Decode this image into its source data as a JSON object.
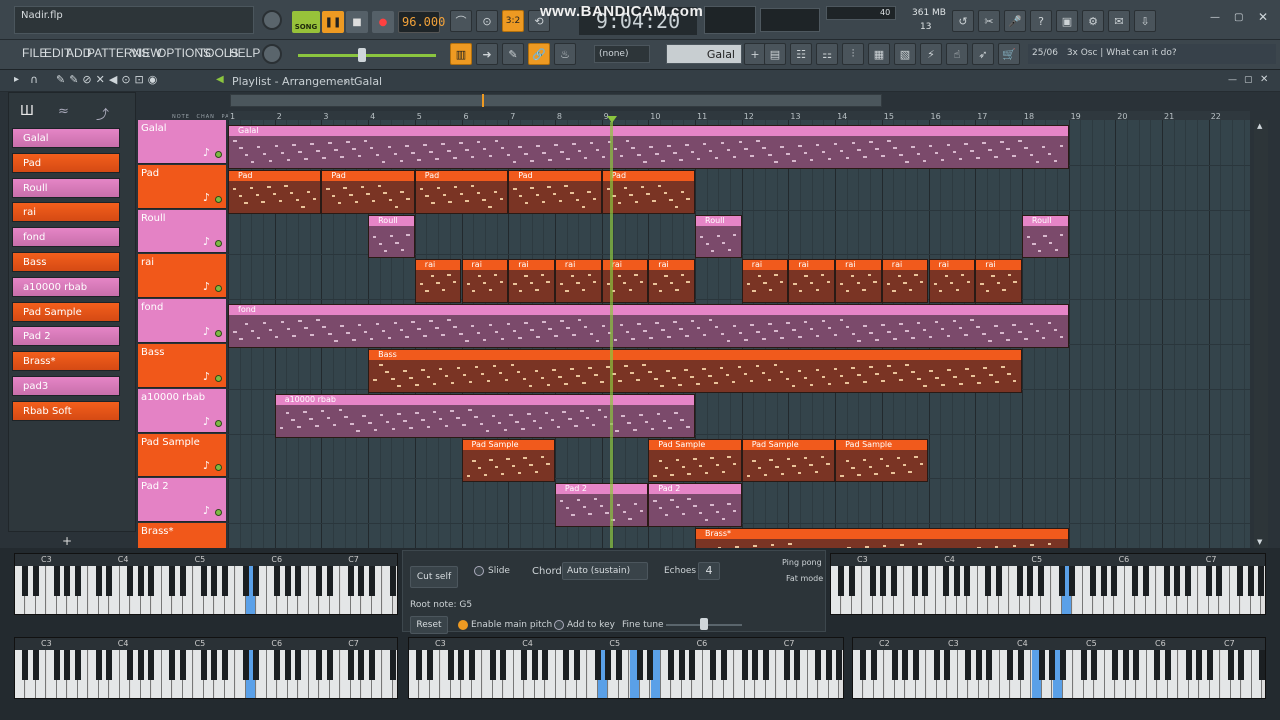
{
  "app": {
    "file_name": "Nadir.flp",
    "watermark": "www.BANDICAM.com",
    "tempo": "96.000",
    "time": "9:04:20",
    "song_label": "SONG",
    "pattern_num": "3:2",
    "memory": "361 MB",
    "cpu_val": "40",
    "poly": "13",
    "hint_num": "25/06",
    "hint_text": "3x Osc | What can it do?",
    "snap_select": "(none)",
    "pattern_select": "Galal"
  },
  "menu": [
    "FILE",
    "EDIT",
    "ADD",
    "PATTERNS",
    "VIEW",
    "OPTIONS",
    "TOOLS",
    "HELP"
  ],
  "playlist": {
    "title": "Playlist - Arrangement",
    "pattern": "Galal",
    "sub_labels": [
      "NOTE",
      "CHAN",
      "PAT"
    ]
  },
  "patterns": [
    {
      "name": "Galal",
      "color": "pink"
    },
    {
      "name": "Pad",
      "color": "orange"
    },
    {
      "name": "Roull",
      "color": "pink"
    },
    {
      "name": "rai",
      "color": "orange"
    },
    {
      "name": "fond",
      "color": "pink"
    },
    {
      "name": "Bass",
      "color": "orange"
    },
    {
      "name": "a10000 rbab",
      "color": "pink"
    },
    {
      "name": "Pad Sample",
      "color": "orange"
    },
    {
      "name": "Pad 2",
      "color": "pink"
    },
    {
      "name": "Brass*",
      "color": "orange"
    },
    {
      "name": "pad3",
      "color": "pink"
    },
    {
      "name": "Rbab Soft",
      "color": "orange"
    }
  ],
  "tracks": [
    {
      "name": "Galal",
      "color": "pink"
    },
    {
      "name": "Pad",
      "color": "orange"
    },
    {
      "name": "Roull",
      "color": "pink"
    },
    {
      "name": "rai",
      "color": "orange"
    },
    {
      "name": "fond",
      "color": "pink"
    },
    {
      "name": "Bass",
      "color": "orange"
    },
    {
      "name": "a10000 rbab",
      "color": "pink"
    },
    {
      "name": "Pad Sample",
      "color": "orange"
    },
    {
      "name": "Pad 2",
      "color": "pink"
    },
    {
      "name": "Brass*",
      "color": "orange"
    }
  ],
  "ruler": [
    "1",
    "2",
    "3",
    "4",
    "5",
    "6",
    "7",
    "8",
    "9",
    "10",
    "11",
    "12",
    "13",
    "14",
    "15",
    "16",
    "17",
    "18",
    "19",
    "20",
    "21",
    "22"
  ],
  "clips": [
    {
      "track": 0,
      "label": "Galal",
      "start": 1,
      "end": 19,
      "color": "pink"
    },
    {
      "track": 1,
      "label": "Pad",
      "start": 1,
      "end": 3,
      "color": "orange"
    },
    {
      "track": 1,
      "label": "Pad",
      "start": 3,
      "end": 5,
      "color": "orange"
    },
    {
      "track": 1,
      "label": "Pad",
      "start": 5,
      "end": 7,
      "color": "orange"
    },
    {
      "track": 1,
      "label": "Pad",
      "start": 7,
      "end": 9,
      "color": "orange"
    },
    {
      "track": 1,
      "label": "Pad",
      "start": 9,
      "end": 11,
      "color": "orange"
    },
    {
      "track": 2,
      "label": "Roull",
      "start": 4,
      "end": 5,
      "color": "pink"
    },
    {
      "track": 2,
      "label": "Roull",
      "start": 11,
      "end": 12,
      "color": "pink"
    },
    {
      "track": 2,
      "label": "Roull",
      "start": 18,
      "end": 19,
      "color": "pink"
    },
    {
      "track": 3,
      "label": "rai",
      "start": 5,
      "end": 6,
      "color": "orange"
    },
    {
      "track": 3,
      "label": "rai",
      "start": 6,
      "end": 7,
      "color": "orange"
    },
    {
      "track": 3,
      "label": "rai",
      "start": 7,
      "end": 8,
      "color": "orange"
    },
    {
      "track": 3,
      "label": "rai",
      "start": 8,
      "end": 9,
      "color": "orange"
    },
    {
      "track": 3,
      "label": "rai",
      "start": 9,
      "end": 10,
      "color": "orange"
    },
    {
      "track": 3,
      "label": "rai",
      "start": 10,
      "end": 11,
      "color": "orange"
    },
    {
      "track": 3,
      "label": "rai",
      "start": 12,
      "end": 13,
      "color": "orange"
    },
    {
      "track": 3,
      "label": "rai",
      "start": 13,
      "end": 14,
      "color": "orange"
    },
    {
      "track": 3,
      "label": "rai",
      "start": 14,
      "end": 15,
      "color": "orange"
    },
    {
      "track": 3,
      "label": "rai",
      "start": 15,
      "end": 16,
      "color": "orange"
    },
    {
      "track": 3,
      "label": "rai",
      "start": 16,
      "end": 17,
      "color": "orange"
    },
    {
      "track": 3,
      "label": "rai",
      "start": 17,
      "end": 18,
      "color": "orange"
    },
    {
      "track": 4,
      "label": "fond",
      "start": 1,
      "end": 19,
      "color": "pink"
    },
    {
      "track": 5,
      "label": "Bass",
      "start": 4,
      "end": 18,
      "color": "orange"
    },
    {
      "track": 6,
      "label": "a10000 rbab",
      "start": 2,
      "end": 11,
      "color": "pink"
    },
    {
      "track": 7,
      "label": "Pad Sample",
      "start": 6,
      "end": 8,
      "color": "orange"
    },
    {
      "track": 7,
      "label": "Pad Sample",
      "start": 10,
      "end": 12,
      "color": "orange"
    },
    {
      "track": 7,
      "label": "Pad Sample",
      "start": 12,
      "end": 14,
      "color": "orange"
    },
    {
      "track": 7,
      "label": "Pad Sample",
      "start": 14,
      "end": 16,
      "color": "orange"
    },
    {
      "track": 8,
      "label": "Pad 2",
      "start": 8,
      "end": 10,
      "color": "pink"
    },
    {
      "track": 8,
      "label": "Pad 2",
      "start": 10,
      "end": 12,
      "color": "pink"
    },
    {
      "track": 9,
      "label": "Brass*",
      "start": 11,
      "end": 19,
      "color": "orange"
    }
  ],
  "playhead_bar": 9.2,
  "keyboard_labels": [
    "C3",
    "C4",
    "C5",
    "C6",
    "C7"
  ],
  "keyboard_labels_c2": [
    "C2",
    "C3",
    "C4",
    "C5",
    "C6",
    "C7"
  ],
  "panel": {
    "cut_self": "Cut self",
    "slide": "Slide",
    "chord_label": "Chord",
    "chord_value": "Auto (sustain)",
    "echoes_label": "Echoes",
    "echoes_value": "4",
    "ping_pong": "Ping pong",
    "fat_mode": "Fat mode",
    "root_note": "Root note: G5",
    "reset": "Reset",
    "enable_pitch": "Enable main pitch",
    "add_key": "Add to key",
    "fine_tune": "Fine tune"
  },
  "colors": {
    "orange": "#f15a1c",
    "pink": "#e685c7",
    "accent": "#ee9a22",
    "playhead": "#8bc53f"
  }
}
